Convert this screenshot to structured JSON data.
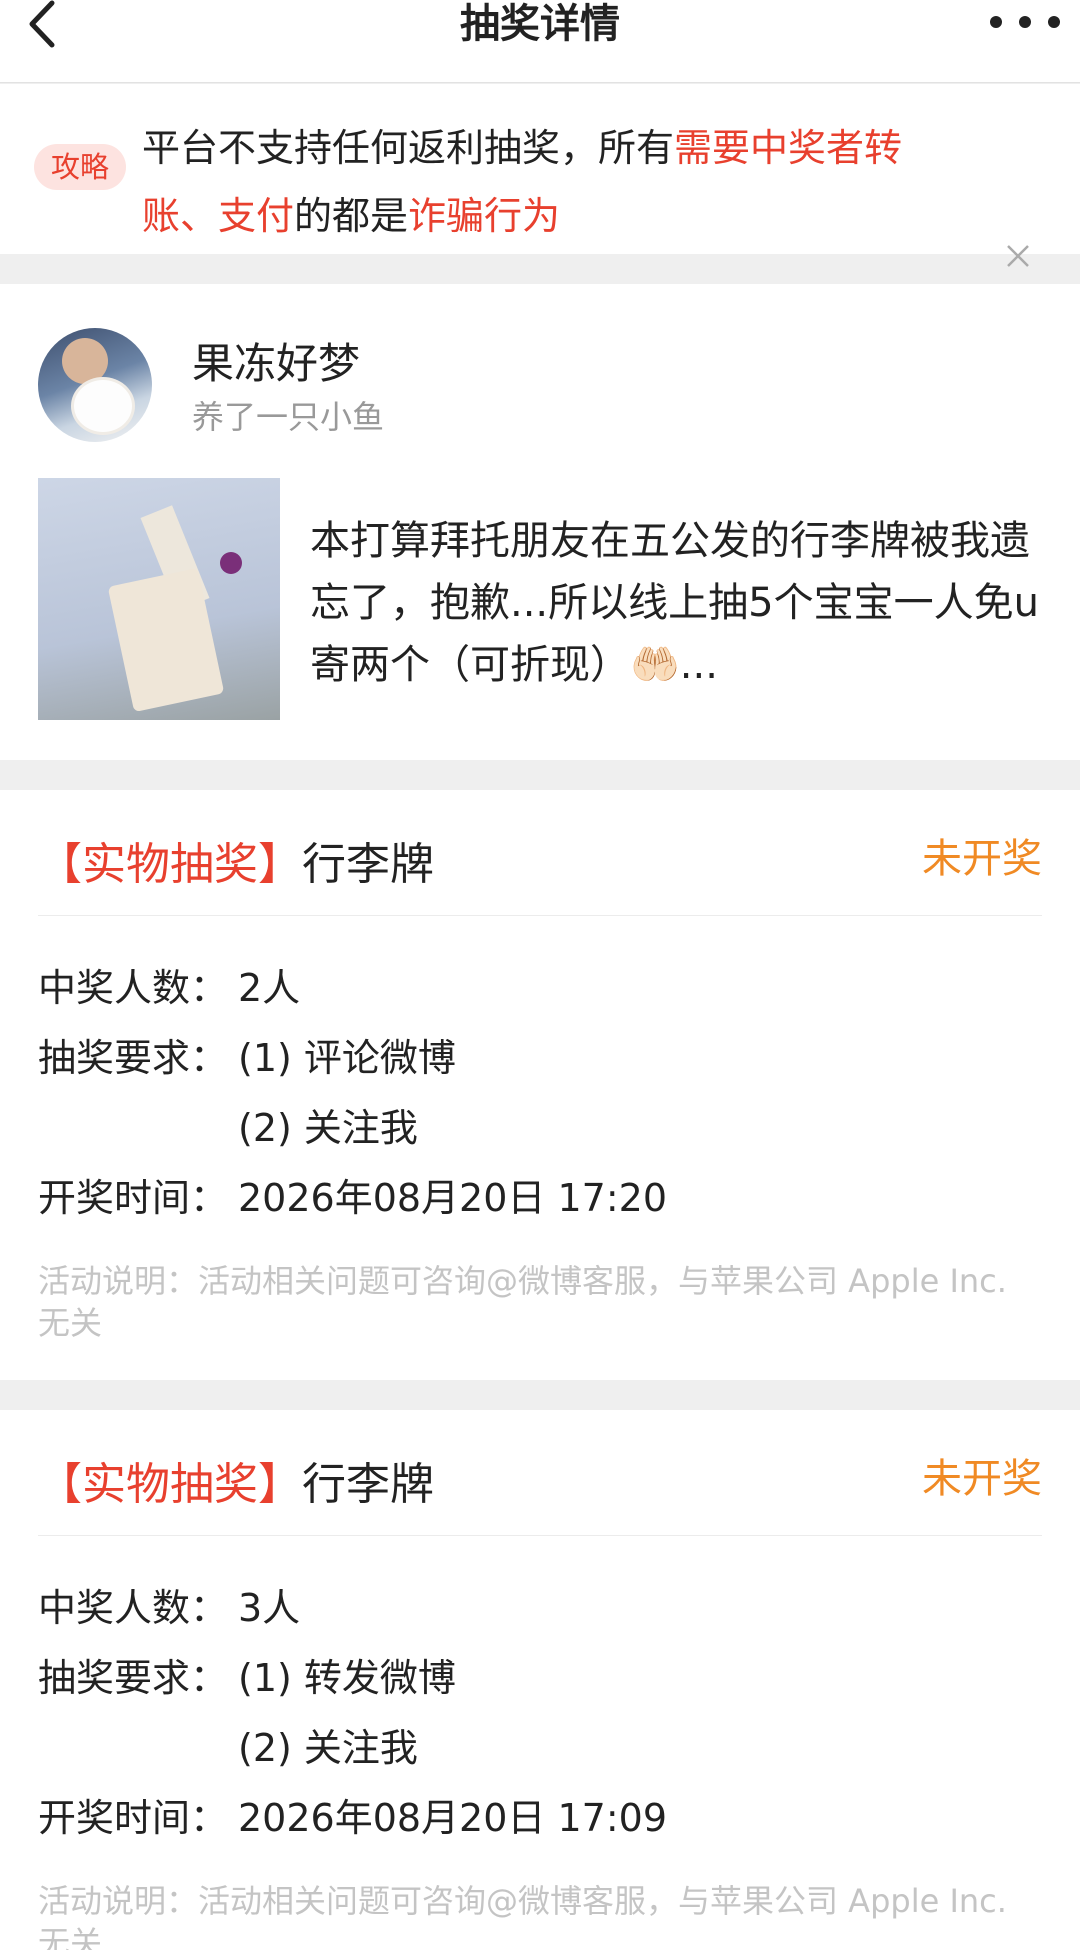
{
  "nav": {
    "title": "抽奖详情"
  },
  "notice": {
    "badge": "攻略",
    "text_1": "平台不支持任何返利抽奖，所有",
    "highlight_1": "需要中奖者转账、支付",
    "text_2": "的都是",
    "highlight_2": "诈骗行为"
  },
  "post": {
    "username": "果冻好梦",
    "bio": "养了一只小鱼",
    "text": "本打算拜托朋友在五公发的行李牌被我遗忘了，抱歉...所以线上抽5个宝宝一人免u寄两个（可折现）🤲🏻..."
  },
  "lotteries": [
    {
      "type": "【实物抽奖】",
      "prize": "行李牌",
      "status": "未开奖",
      "winners_label": "中奖人数：",
      "winners": "2人",
      "requirements_label": "抽奖要求：",
      "requirement_1": "(1) 评论微博",
      "requirement_2": "(2) 关注我",
      "draw_time_label": "开奖时间：",
      "draw_time": "2026年08月20日 17:20",
      "note": "活动说明：活动相关问题可咨询@微博客服，与苹果公司 Apple Inc. 无关"
    },
    {
      "type": "【实物抽奖】",
      "prize": "行李牌",
      "status": "未开奖",
      "winners_label": "中奖人数：",
      "winners": "3人",
      "requirements_label": "抽奖要求：",
      "requirement_1": "(1) 转发微博",
      "requirement_2": "(2) 关注我",
      "draw_time_label": "开奖时间：",
      "draw_time": "2026年08月20日 17:09",
      "note": "活动说明：活动相关问题可咨询@微博客服，与苹果公司 Apple Inc. 无关"
    }
  ],
  "colors": {
    "accent_red": "#e8402e",
    "status_orange": "#f08a24",
    "muted_gray": "#999999"
  }
}
